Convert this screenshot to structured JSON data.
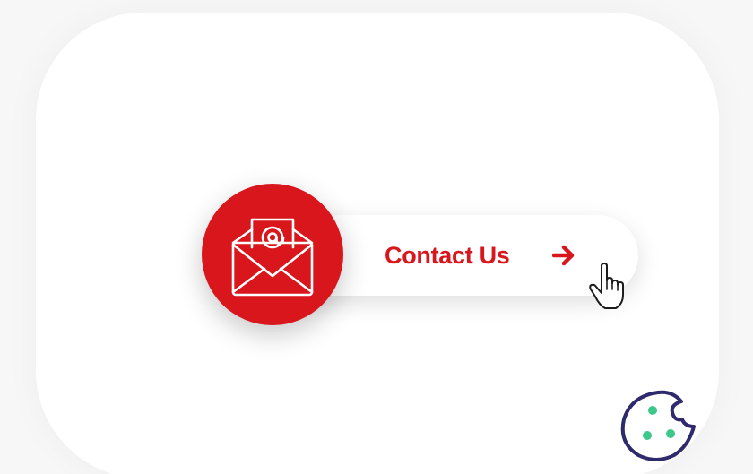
{
  "button": {
    "label": "Contact Us"
  },
  "icons": {
    "mail": "envelope-at-icon",
    "arrow": "arrow-right-icon",
    "cursor": "hand-pointer-icon",
    "cookie": "cookie-icon"
  },
  "colors": {
    "accent": "#d8161c",
    "background": "#f7f7f7",
    "card": "#ffffff",
    "cookie_outline": "#2f2a6b",
    "cookie_dots": "#3cc78b"
  }
}
